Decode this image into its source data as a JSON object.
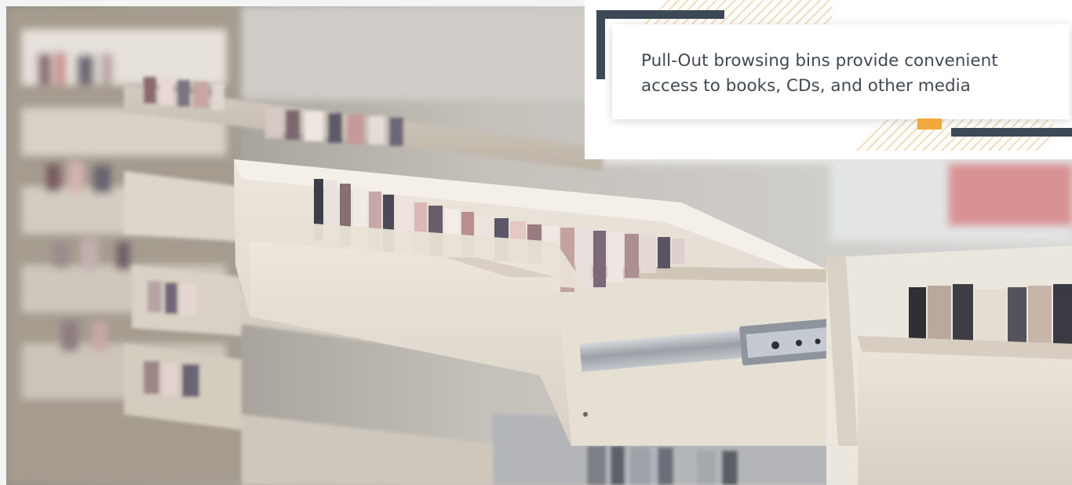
{
  "caption": {
    "text": "Pull-Out browsing bins provide convenient access to books, CDs, and other media"
  },
  "photo": {
    "subject": "pull-out browsing bins with CDs and DVDs"
  },
  "colors": {
    "navy": "#3e4957",
    "orange": "#f2a83b",
    "text": "#3f4a55",
    "hatch": "#f2c98a"
  }
}
